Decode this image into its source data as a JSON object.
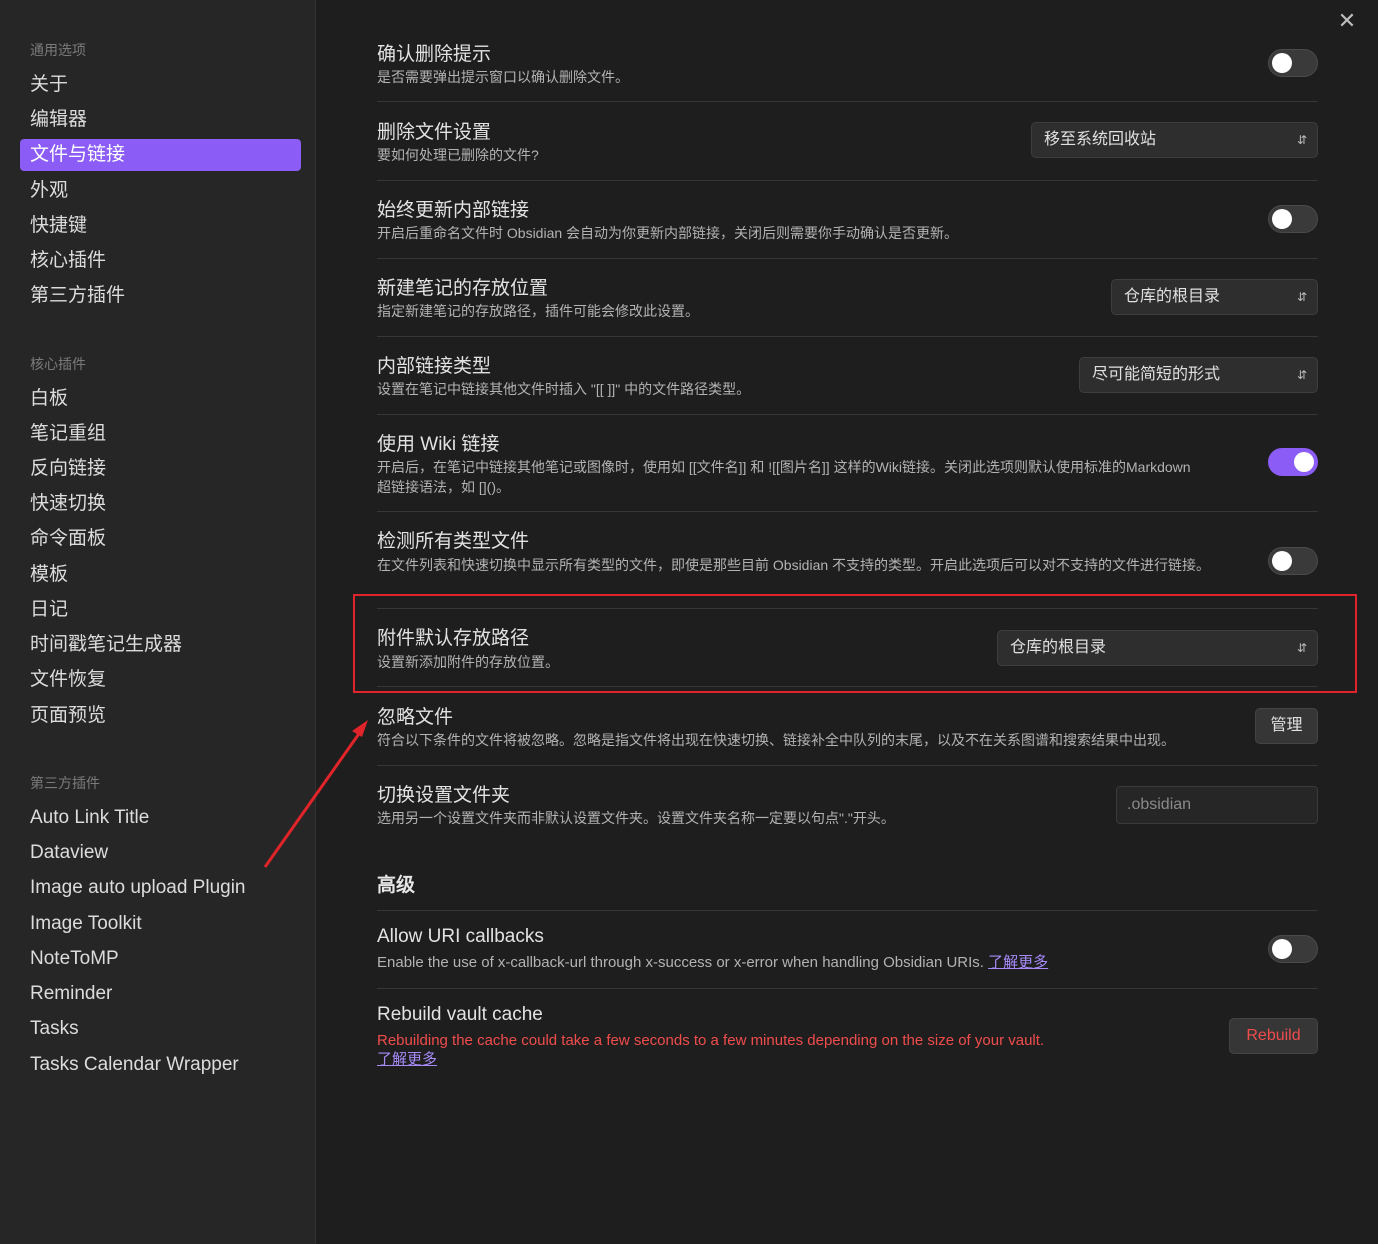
{
  "close_label": "✕",
  "sidebar": {
    "groups": [
      {
        "title": "通用选项",
        "items": [
          {
            "label": "关于"
          },
          {
            "label": "编辑器"
          },
          {
            "label": "文件与链接",
            "active": true
          },
          {
            "label": "外观"
          },
          {
            "label": "快捷键"
          },
          {
            "label": "核心插件"
          },
          {
            "label": "第三方插件"
          }
        ]
      },
      {
        "title": "核心插件",
        "items": [
          {
            "label": "白板"
          },
          {
            "label": "笔记重组"
          },
          {
            "label": "反向链接"
          },
          {
            "label": "快速切换"
          },
          {
            "label": "命令面板"
          },
          {
            "label": "模板"
          },
          {
            "label": "日记"
          },
          {
            "label": "时间戳笔记生成器"
          },
          {
            "label": "文件恢复"
          },
          {
            "label": "页面预览"
          }
        ]
      },
      {
        "title": "第三方插件",
        "items": [
          {
            "label": "Auto Link Title"
          },
          {
            "label": "Dataview"
          },
          {
            "label": "Image auto upload Plugin"
          },
          {
            "label": "Image Toolkit"
          },
          {
            "label": "NoteToMP"
          },
          {
            "label": "Reminder"
          },
          {
            "label": "Tasks"
          },
          {
            "label": "Tasks Calendar Wrapper"
          }
        ]
      }
    ]
  },
  "settings": {
    "confirm_delete": {
      "name": "确认删除提示",
      "desc": "是否需要弹出提示窗口以确认删除文件。",
      "enabled": false
    },
    "delete_files": {
      "name": "删除文件设置",
      "desc": "要如何处理已删除的文件?",
      "value": "移至系统回收站"
    },
    "auto_update_links": {
      "name": "始终更新内部链接",
      "desc": "开启后重命名文件时 Obsidian 会自动为你更新内部链接，关闭后则需要你手动确认是否更新。",
      "enabled": false
    },
    "new_note_location": {
      "name": "新建笔记的存放位置",
      "desc": "指定新建笔记的存放路径，插件可能会修改此设置。",
      "value": "仓库的根目录"
    },
    "link_format": {
      "name": "内部链接类型",
      "desc": "设置在笔记中链接其他文件时插入 \"[[ ]]\" 中的文件路径类型。",
      "value": "尽可能简短的形式"
    },
    "wiki_links": {
      "name": "使用 Wiki 链接",
      "desc": "开启后，在笔记中链接其他笔记或图像时，使用如 [[文件名]] 和 ![[图片名]] 这样的Wiki链接。关闭此选项则默认使用标准的Markdown 超链接语法，如 []()。",
      "enabled": true
    },
    "detect_all_types": {
      "name": "检测所有类型文件",
      "desc": "在文件列表和快速切换中显示所有类型的文件，即使是那些目前 Obsidian 不支持的类型。开启此选项后可以对不支持的文件进行链接。",
      "enabled": false
    },
    "attachment_folder": {
      "name": "附件默认存放路径",
      "desc": "设置新添加附件的存放位置。",
      "value": "仓库的根目录"
    },
    "excluded_files": {
      "name": "忽略文件",
      "desc": "符合以下条件的文件将被忽略。忽略是指文件将出现在快速切换、链接补全中队列的末尾，以及不在关系图谱和搜索结果中出现。",
      "button": "管理"
    },
    "config_folder": {
      "name": "切换设置文件夹",
      "desc": "选用另一个设置文件夹而非默认设置文件夹。设置文件夹名称一定要以句点\".\"开头。",
      "placeholder": ".obsidian"
    }
  },
  "advanced": {
    "heading": "高级",
    "uri_callbacks": {
      "name": "Allow URI callbacks",
      "desc": "Enable the use of x-callback-url through x-success or x-error when handling Obsidian URIs.",
      "link": "了解更多",
      "enabled": false
    },
    "rebuild_cache": {
      "name": "Rebuild vault cache",
      "desc": "Rebuilding the cache could take a few seconds to a few minutes depending on the size of your vault.",
      "link": "了解更多",
      "button": "Rebuild"
    }
  },
  "colors": {
    "accent": "#8b5cf6",
    "highlight": "#e0242a",
    "danger": "#f14c4c"
  }
}
